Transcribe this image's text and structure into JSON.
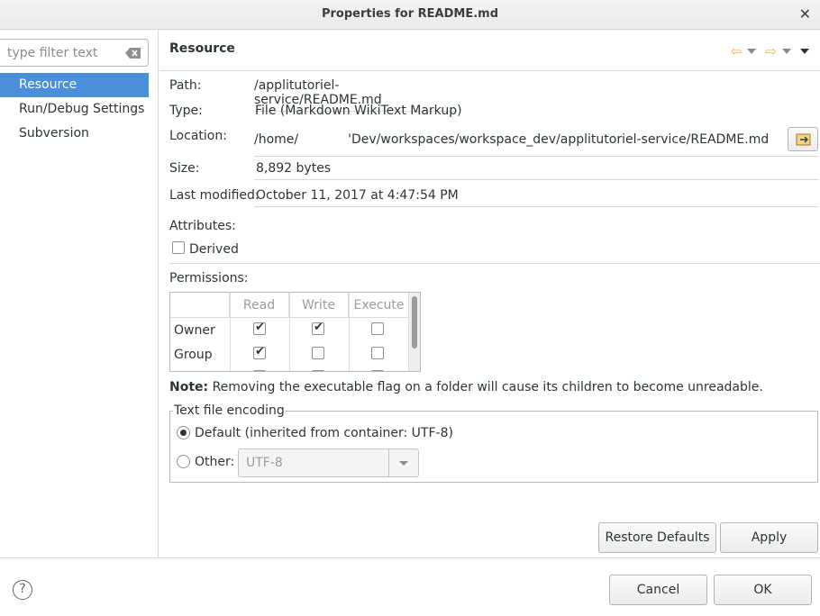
{
  "window": {
    "title": "Properties for README.md"
  },
  "sidebar": {
    "filter_placeholder": "type filter text",
    "items": [
      {
        "label": "Resource",
        "selected": true
      },
      {
        "label": "Run/Debug Settings",
        "selected": false
      },
      {
        "label": "Subversion",
        "selected": false
      }
    ]
  },
  "header": {
    "title": "Resource"
  },
  "resource": {
    "path_label": "Path:",
    "path_value": "/applitutoriel-service/README.md",
    "type_label": "Type:",
    "type_value": "File  (Markdown WikiText Markup)",
    "location_label": "Location:",
    "location_prefix": "/home/",
    "location_suffix": "'Dev/workspaces/workspace_dev/applitutoriel-service/README.md",
    "size_label": "Size:",
    "size_value": "8,892  bytes",
    "modified_label": "Last modified:",
    "modified_value": "October 11, 2017 at 4:47:54 PM",
    "attributes_label": "Attributes:",
    "derived_label": "Derived",
    "derived_checked": false,
    "permissions_label": "Permissions:"
  },
  "permissions": {
    "columns": [
      "Read",
      "Write",
      "Execute"
    ],
    "rows": [
      {
        "label": "Owner",
        "read": true,
        "write": true,
        "execute": false
      },
      {
        "label": "Group",
        "read": true,
        "write": false,
        "execute": false
      }
    ]
  },
  "note": {
    "bold": "Note:",
    "text": " Removing the executable flag on a folder will cause its children to become unreadable."
  },
  "encoding": {
    "legend": "Text file encoding",
    "default_label": "Default (inherited from container: UTF-8)",
    "default_selected": true,
    "other_label": "Other:",
    "other_value": "UTF-8"
  },
  "buttons": {
    "restore_defaults": "Restore Defaults",
    "apply": "Apply",
    "cancel": "Cancel",
    "ok": "OK"
  },
  "icons": {
    "close": "close-icon",
    "clear": "clear-filter-icon",
    "back": "back-arrow-icon",
    "forward": "forward-arrow-icon",
    "menu": "view-menu-icon",
    "help": "help-icon",
    "open_location": "open-location-icon"
  },
  "colors": {
    "selection": "#4a90d9",
    "arrow": "#e8b444"
  }
}
